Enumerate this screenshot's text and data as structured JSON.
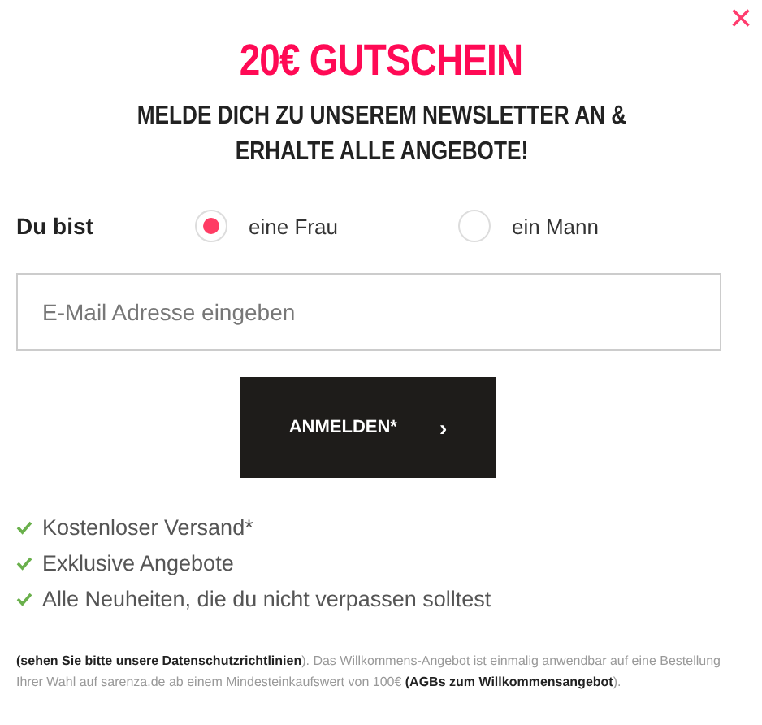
{
  "close": "×",
  "title": "20€ GUTSCHEIN",
  "subtitle": "MELDE DICH ZU UNSEREM NEWSLETTER AN & ERHALTE ALLE ANGEBOTE!",
  "gender": {
    "label": "Du bist",
    "options": [
      {
        "label": "eine Frau",
        "selected": true
      },
      {
        "label": "ein Mann",
        "selected": false
      }
    ]
  },
  "email": {
    "placeholder": "E-Mail Adresse eingeben"
  },
  "submit": {
    "label": "ANMELDEN*",
    "arrow": "›"
  },
  "benefits": [
    "Kostenloser Versand*",
    "Exklusive Angebote",
    "Alle Neuheiten, die du nicht verpassen solltest"
  ],
  "footnote": "**(sehen Sie bitte unsere Datenschutzrichtlinien**). Das Willkommens-Angebot ist einmalig anwendbar auf eine Bestellung Ihrer Wahl auf sarenza.de ab einem Mindesteinkaufswert von 100€ **(AGBs zum Willkommensangebot**)."
}
